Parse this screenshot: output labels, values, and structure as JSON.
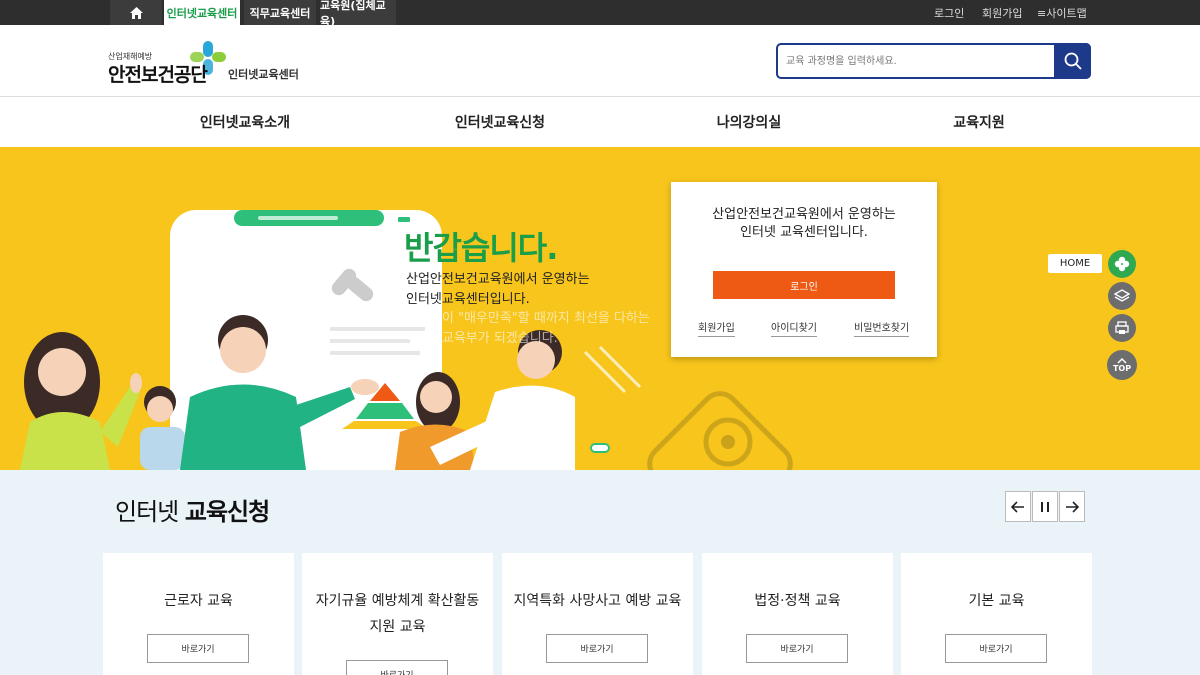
{
  "topbar": {
    "tabs": [
      "인터넷교육센터",
      "직무교육센터",
      "교육원(집체교육)"
    ],
    "utils": [
      "로그인",
      "회원가입",
      "≡사이트맵"
    ]
  },
  "header": {
    "logo_small": "산업재해예방",
    "logo_big": "안전보건공단",
    "logo_sub": "인터넷교육센터",
    "search_placeholder": "교육 과정명을 입력하세요."
  },
  "gnb": [
    "인터넷교육소개",
    "인터넷교육신청",
    "나의강의실",
    "교육지원"
  ],
  "hero": {
    "headline": "반갑습니다.",
    "lines": [
      "산업안전보건교육원에서 운영하는",
      "인터넷교육센터입니다.",
      "고객님이 \"매우만족\"할 때까지 최선을 다하는",
      "이러닝교육부가 되겠습니다."
    ]
  },
  "login_box": {
    "message_line1": "산업안전보건교육원에서 운영하는",
    "message_line2": "인터넷 교육센터입니다.",
    "login_button": "로그인",
    "links": [
      "회원가입",
      "아이디찾기",
      "비밀번호찾기"
    ]
  },
  "quick_menu": {
    "home_label": "HOME",
    "top_label": "TOP"
  },
  "courses": {
    "title_light": "인터넷 ",
    "title_bold": "교육신청",
    "cards": [
      {
        "name": "근로자 교육",
        "button": "바로가기"
      },
      {
        "name": "자기규율 예방체계 확산활동 지원 교육",
        "button": "바로가기"
      },
      {
        "name": "지역특화 사망사고 예방 교육",
        "button": "바로가기"
      },
      {
        "name": "법정·정책 교육",
        "button": "바로가기"
      },
      {
        "name": "기본 교육",
        "button": "바로가기"
      }
    ]
  },
  "colors": {
    "green": "#1a9e4a",
    "navy": "#1d3a8a",
    "yellow": "#f7c51b",
    "orange": "#ee5a14"
  }
}
